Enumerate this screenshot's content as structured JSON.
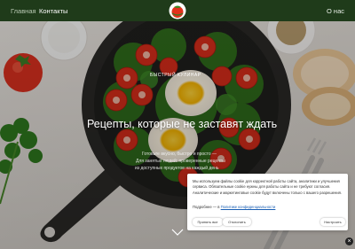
{
  "nav": {
    "home": "Главная",
    "contacts": "Контакты",
    "about": "О нас"
  },
  "hero": {
    "tagline": "БЫСТРЫЙ КУЛИНАР",
    "headline": "Рецепты, которые не заставят ждать",
    "sub_line_1": "Готовьте вкусно, быстро и просто —",
    "sub_line_2": "Для занятых людей: проверенные рецепты",
    "sub_line_3": "из доступных продуктов на каждый день"
  },
  "cookie": {
    "text": "Мы используем файлы cookie для корректной работы сайта, аналитики и улучшения сервиса. Обязательные cookie нужны для работы сайта и не требуют согласия. Аналитические и маркетинговые cookie будут включены только с вашего разрешения.",
    "more_label": "Подробнее — в",
    "policy_link": "Политике конфиденциальности",
    "accept": "Принять все",
    "reject": "Отклонить",
    "settings": "Настроить"
  },
  "icons": {
    "logo": "tomato-logo-icon",
    "scroll": "chevron-down-icon",
    "close": "close-icon"
  },
  "colors": {
    "nav_bg": "#1f3b1a",
    "accent": "#1a5fb4"
  }
}
